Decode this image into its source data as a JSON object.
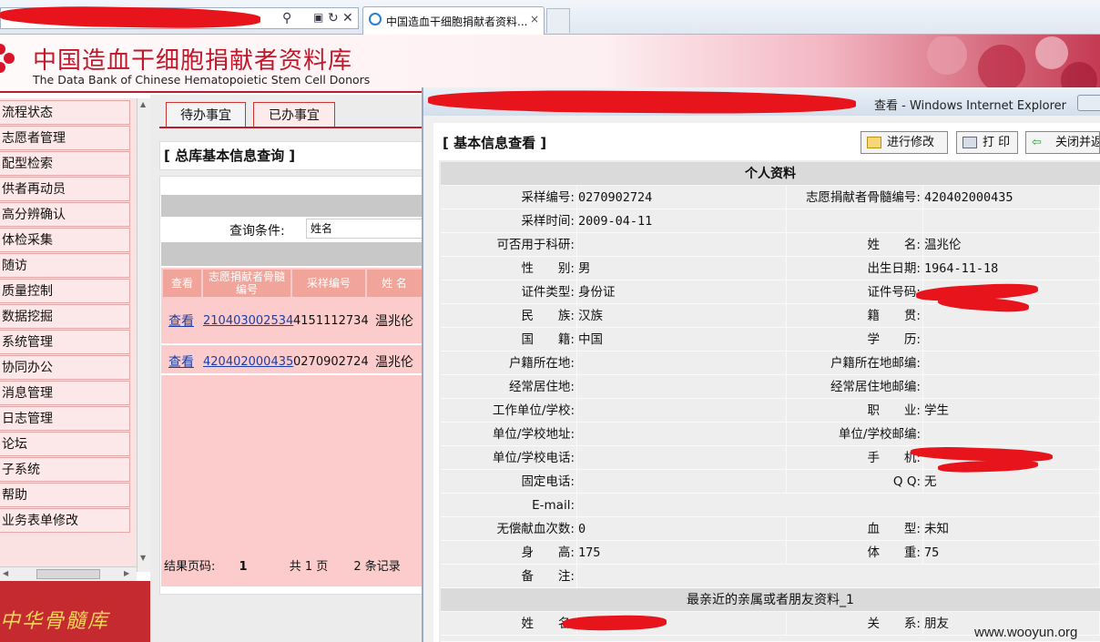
{
  "browser": {
    "tab_title": "中国造血干细胞捐献者资料...",
    "addr_icons": [
      "search-icon",
      "compat-icon",
      "refresh-icon",
      "stop-icon"
    ],
    "tab_close": "×"
  },
  "header": {
    "title": "中国造血干细胞捐献者资料库",
    "subtitle": "The Data Bank of Chinese Hematopoietic Stem Cell Donors"
  },
  "nav": {
    "items": [
      "流程状态",
      "志愿者管理",
      "配型检索",
      "供者再动员",
      "高分辨确认",
      "体检采集",
      "随访",
      "质量控制",
      "数据挖掘",
      "系统管理",
      "协同办公",
      "消息管理",
      "日志管理",
      "论坛",
      "子系统",
      "帮助",
      "业务表单修改"
    ],
    "footer": "中华骨髓库"
  },
  "middle": {
    "tabs": [
      "待办事宜",
      "已办事宜"
    ],
    "title": "[ 总库基本信息查询 ]",
    "condition_label": "查询条件:",
    "condition_value": "姓名",
    "columns": [
      "查看",
      "志愿捐献者骨髓编号",
      "采样编号",
      "姓 名"
    ],
    "rows": [
      {
        "view": "查看",
        "donor_no": "210403002534",
        "sample_no": "4151112734",
        "name": "温兆伦"
      },
      {
        "view": "查看",
        "donor_no": "420402000435",
        "sample_no": "0270902724",
        "name": "温兆伦"
      }
    ],
    "footer": {
      "label": "结果页码:",
      "page": "1",
      "total": "共 1 页",
      "count": "2 条记录"
    }
  },
  "popup": {
    "window_title": "查看 - Windows Internet Explorer",
    "heading": "[ 基本信息查看 ]",
    "buttons": {
      "edit": "进行修改",
      "print": "打 印",
      "close": "关闭并返"
    },
    "section_personal": "个人资料",
    "section_relative": "最亲近的亲属或者朋友资料_1",
    "fields": {
      "sample_no_label": "采样编号:",
      "sample_no": "0270902724",
      "donor_no_label": "志愿捐献者骨髓编号:",
      "donor_no": "420402000435",
      "sample_time_label": "采样时间:",
      "sample_time": "2009-04-11",
      "research_label": "可否用于科研:",
      "research": "",
      "name_label": "姓　　名:",
      "name": "温兆伦",
      "gender_label": "性　　别:",
      "gender": "男",
      "dob_label": "出生日期:",
      "dob": "1964-11-18",
      "idtype_label": "证件类型:",
      "idtype": "身份证",
      "idno_label": "证件号码:",
      "idno": "",
      "ethnic_label": "民　　族:",
      "ethnic": "汉族",
      "native_label": "籍　　贯:",
      "native": "",
      "nation_label": "国　　籍:",
      "nation": "中国",
      "edu_label": "学　　历:",
      "edu": "",
      "hukou_label": "户籍所在地:",
      "hukou": "",
      "hukou_zip_label": "户籍所在地邮编:",
      "hukou_zip": "",
      "residence_label": "经常居住地:",
      "residence": "",
      "residence_zip_label": "经常居住地邮编:",
      "residence_zip": "",
      "work_label": "工作单位/学校:",
      "work": "",
      "job_label": "职　　业:",
      "job": "学生",
      "work_addr_label": "单位/学校地址:",
      "work_addr": "",
      "work_zip_label": "单位/学校邮编:",
      "work_zip": "",
      "work_tel_label": "单位/学校电话:",
      "work_tel": "",
      "mobile_label": "手　　机:",
      "mobile": "",
      "phone_label": "固定电话:",
      "phone": "",
      "qq_label": "Q Q:",
      "qq": "无",
      "email_label": "E-mail:",
      "email": "",
      "donations_label": "无偿献血次数:",
      "donations": "0",
      "blood_label": "血　　型:",
      "blood": "未知",
      "height_label": "身　　高:",
      "height": "175",
      "weight_label": "体　　重:",
      "weight": "75",
      "remark_label": "备　　注:",
      "remark": "",
      "rel_name_label": "姓　　名:",
      "rel_name": "",
      "relation_label": "关　　系:",
      "relation": "朋友"
    }
  },
  "watermark": "www.wooyun.org"
}
